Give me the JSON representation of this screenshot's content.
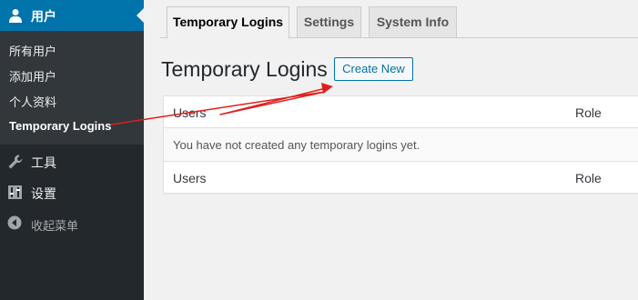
{
  "sidebar": {
    "users_menu": {
      "label": "用户",
      "icon": "user-icon"
    },
    "submenu": [
      {
        "label": "所有用户"
      },
      {
        "label": "添加用户"
      },
      {
        "label": "个人资料"
      },
      {
        "label": "Temporary Logins"
      }
    ],
    "tools": {
      "label": "工具",
      "icon": "wrench-icon"
    },
    "settings": {
      "label": "设置",
      "icon": "settings-icon"
    },
    "collapse": {
      "label": "收起菜单",
      "icon": "collapse-icon"
    }
  },
  "tabs": [
    {
      "label": "Temporary Logins"
    },
    {
      "label": "Settings"
    },
    {
      "label": "System Info"
    }
  ],
  "page": {
    "title": "Temporary Logins",
    "create_button": "Create New"
  },
  "table": {
    "columns": [
      "Users",
      "Role"
    ],
    "empty_message": "You have not created any temporary logins yet.",
    "footer": [
      "Users",
      "Role"
    ]
  },
  "colors": {
    "sidebar_bg": "#23282d",
    "accent": "#0073aa",
    "annotation_arrow": "#e0201b"
  }
}
